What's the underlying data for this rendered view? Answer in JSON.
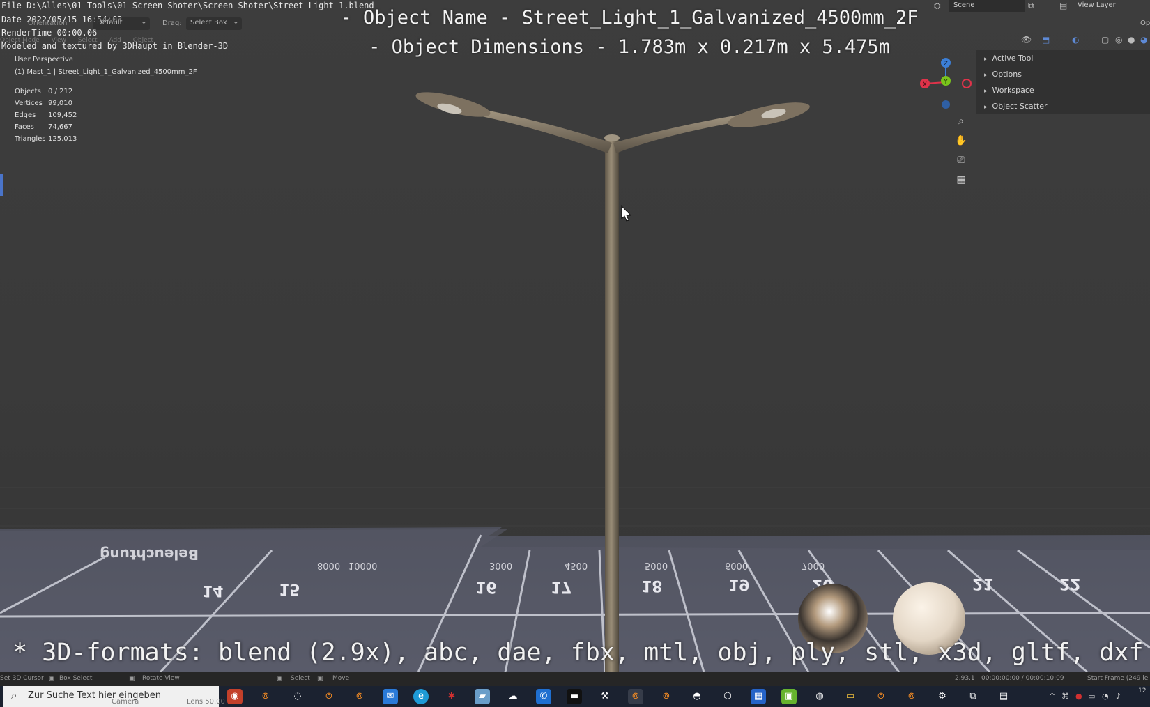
{
  "stamp": {
    "file": "File D:\\Alles\\01_Tools\\01_Screen Shoter\\Screen Shoter\\Street_Light_1.blend",
    "date": "Date 2022/05/15 16:54:03",
    "render_time": "RenderTime 00:00.06",
    "credit": "Modeled and textured by 3DHaupt in Blender-3D"
  },
  "header": {
    "orientation_label": "Orientation",
    "orientation_value": "Default",
    "drag_label": "Drag:",
    "drag_value": "Select Box",
    "menu": [
      "Object Mode",
      "View",
      "Select",
      "Add",
      "Object"
    ]
  },
  "overlay": {
    "name_line": "- Object Name - Street_Light_1_Galvanized_4500mm_2F",
    "dims_line": "- Object Dimensions -  1.783m x 0.217m x 5.475m",
    "formats_line": "* 3D-formats: blend (2.9x), abc, dae, fbx, mtl, obj, ply, stl, x3d, gltf, dxf"
  },
  "viewport_info": {
    "perspective": "User Perspective",
    "active_object": "(1) Mast_1 | Street_Light_1_Galvanized_4500mm_2F",
    "stats": [
      {
        "label": "Objects",
        "value": "0 / 212"
      },
      {
        "label": "Vertices",
        "value": "99,010"
      },
      {
        "label": "Edges",
        "value": "109,452"
      },
      {
        "label": "Faces",
        "value": "74,667"
      },
      {
        "label": "Triangles",
        "value": "125,013"
      }
    ]
  },
  "top_right": {
    "scene": "Scene",
    "view_layer": "View Layer",
    "options": "Op"
  },
  "side_panel": {
    "items": [
      "Active Tool",
      "Options",
      "Workspace",
      "Object Scatter"
    ]
  },
  "gizmo": {
    "x": "X",
    "y": "Y",
    "z": "Z"
  },
  "floor_numbers": [
    "14",
    "15",
    "16",
    "17",
    "18",
    "19",
    "20",
    "21",
    "22"
  ],
  "floor_mm": [
    "8000",
    "10000",
    "3000",
    "4500",
    "5000",
    "6000",
    "7000"
  ],
  "floor_title": "Beleuchtung",
  "statusbar": {
    "cursor": "Set 3D Cursor",
    "box_select": "Box Select",
    "rotate": "Rotate View",
    "select": "Select",
    "move": "Move",
    "version": "2.93.1",
    "timecode": "00:00:00:00 / 00:00:10:09",
    "start_frame": "Start Frame (249 le"
  },
  "taskbar": {
    "search_placeholder": "Zur Suche Text hier eingeben",
    "ghost_camera": "Camera",
    "ghost_lens": "Lens 50.00",
    "clock": "12"
  },
  "colors": {
    "viewport": "#3a3a3a",
    "gizmo_x": "#e0334a",
    "gizmo_y": "#7ac51c",
    "gizmo_z": "#3c7fd6",
    "taskbar": "#1b2230"
  }
}
